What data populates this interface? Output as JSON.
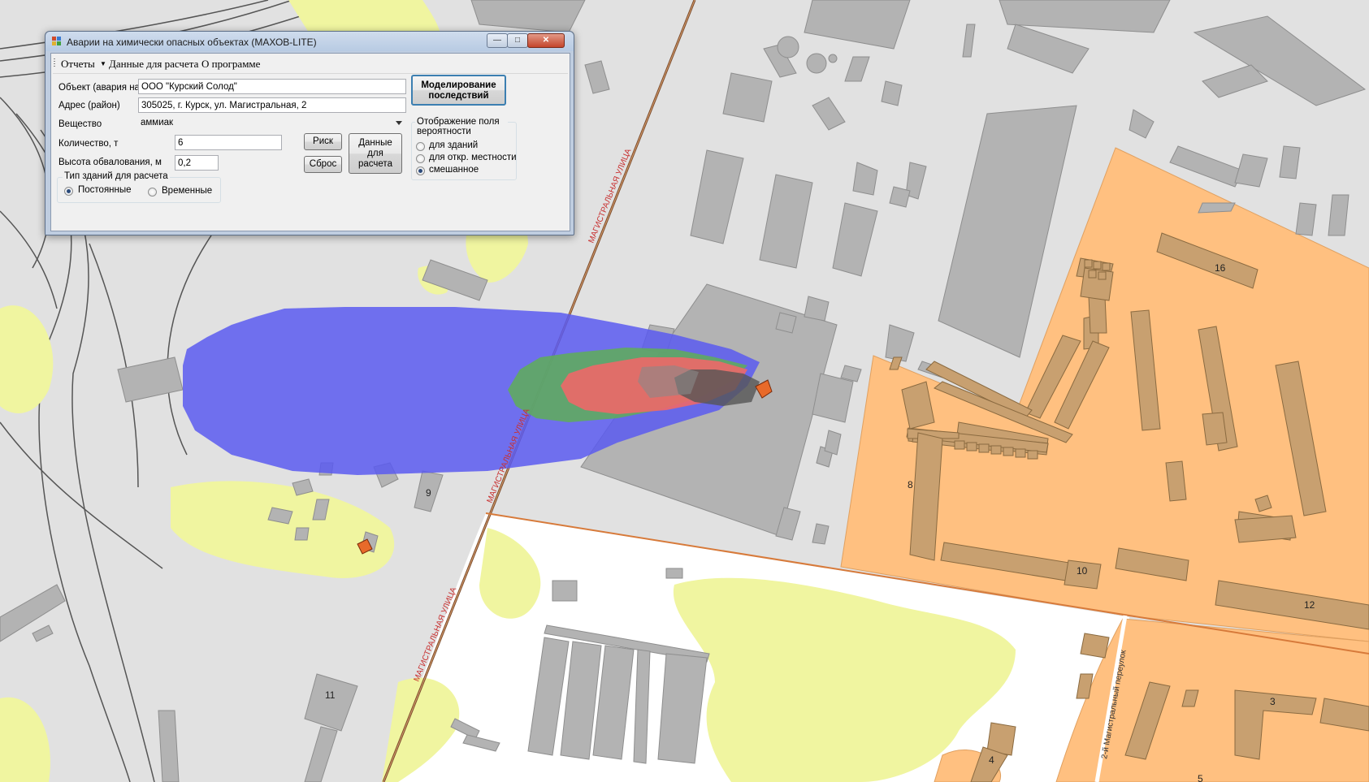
{
  "window": {
    "title": "Аварии на химически опасных объектах (МАХОВ-LITE)",
    "minimize_glyph": "—",
    "maximize_glyph": "□",
    "close_glyph": "✕"
  },
  "menu": {
    "reports": "Отчеты",
    "calc_data": "Данные для расчета",
    "about": "О программе"
  },
  "form": {
    "object_label": "Объект (авария на)",
    "object_value": "ООО \"Курский Солод\"",
    "address_label": "Адрес (район)",
    "address_value": "305025, г. Курск, ул. Магистральная, 2",
    "substance_label": "Вещество",
    "substance_value": "аммиак",
    "quantity_label": "Количество, т",
    "quantity_value": "6",
    "embank_label": "Высота обвалования, м",
    "embank_value": "0,2",
    "risk_button": "Риск",
    "reset_button": "Сброс",
    "calc_data_button": "Данные для расчета",
    "model_button": "Моделирование последствий",
    "building_group": {
      "title": "Тип зданий для расчета",
      "options": [
        "Постоянные",
        "Временные"
      ],
      "selected": 0
    },
    "display_group": {
      "title": "Отображение поля вероятности",
      "options": [
        "для зданий",
        "для откр. местности",
        "смешанное"
      ],
      "selected": 2
    }
  },
  "map": {
    "colors": {
      "ground": "#e1e1e1",
      "building": "#b3b3b3",
      "residential": "#ffc080",
      "vegetation": "#f0f5a0",
      "zone_blue": "#5a5af0",
      "zone_green": "#5faa5f",
      "zone_red": "#ee6868",
      "zone_dark": "#555555"
    },
    "street_labels": [
      "МАГИСТРАЛЬНАЯ УЛИЦА",
      "МАГИСТРАЛЬНАЯ УЛИЦА",
      "МАГИСТРАЛЬНАЯ УЛИЦА",
      "2-й Магистральный переулок"
    ],
    "house_numbers": [
      "16",
      "8",
      "10",
      "12",
      "9",
      "11",
      "3",
      "4",
      "5"
    ]
  }
}
